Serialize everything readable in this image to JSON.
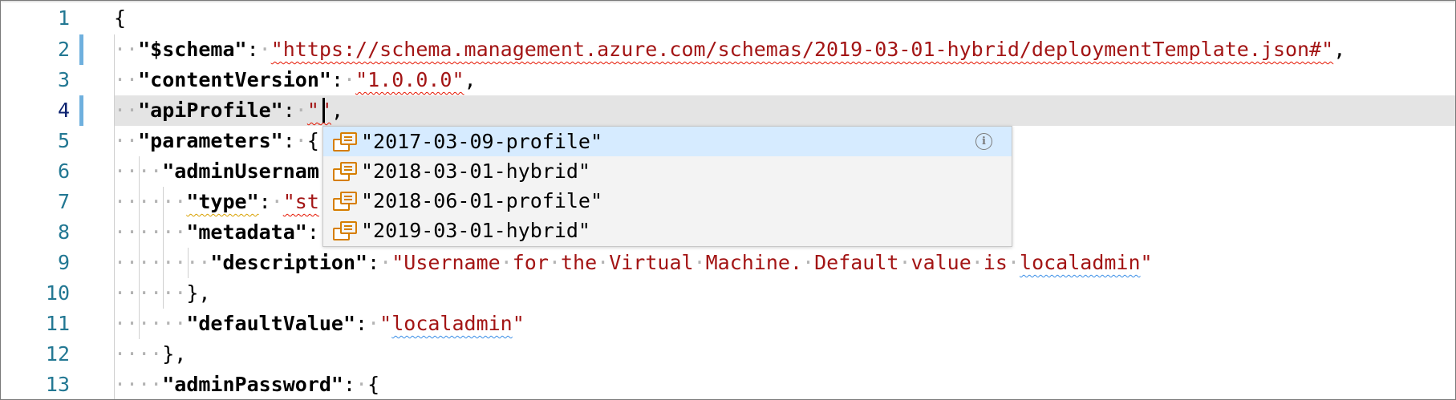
{
  "editor": {
    "language": "json",
    "line_numbers": [
      "1",
      "2",
      "3",
      "4",
      "5",
      "6",
      "7",
      "8",
      "9",
      "10",
      "11",
      "12",
      "13"
    ],
    "active_line": "4",
    "modified_lines": [
      "2",
      "4"
    ],
    "lines": {
      "l1": {
        "brace": "{"
      },
      "l2": {
        "key": "\"$schema\"",
        "colon": ":",
        "value": "\"https://schema.management.azure.com/schemas/2019-03-01-hybrid/deploymentTemplate.json#\"",
        "comma": ","
      },
      "l3": {
        "key": "\"contentVersion\"",
        "colon": ":",
        "value": "\"1.0.0.0\"",
        "comma": ","
      },
      "l4": {
        "key": "\"apiProfile\"",
        "colon": ":",
        "value_open": "\"",
        "value_close": "\"",
        "comma": ","
      },
      "l5": {
        "key": "\"parameters\"",
        "colon": ":",
        "brace": "{"
      },
      "l6": {
        "key": "\"adminUsernam"
      },
      "l7": {
        "key": "\"type\"",
        "colon": ":",
        "value": "\"st"
      },
      "l8": {
        "key": "\"metadata\"",
        "colon": ":"
      },
      "l9": {
        "key": "\"description\"",
        "colon": ":",
        "value_words": [
          "\"Username",
          "for",
          "the",
          "Virtual",
          "Machine.",
          "Default",
          "value",
          "is"
        ],
        "value_last": "localadmin",
        "value_end": "\""
      },
      "l10": {
        "close": "},"
      },
      "l11": {
        "key": "\"defaultValue\"",
        "colon": ":",
        "quote_open": "\"",
        "value": "localadmin",
        "quote_close": "\""
      },
      "l12": {
        "close": "},"
      },
      "l13": {
        "key": "\"adminPassword\"",
        "colon": ":",
        "brace": "{"
      }
    },
    "colors": {
      "string": "#a31515",
      "line_number": "#237893",
      "active_line_number": "#0b216f",
      "gutter_modified": "#6fb0de",
      "current_line_bg": "#e4e4e4",
      "suggest_selected": "#d6ebff"
    }
  },
  "suggest": {
    "items": [
      {
        "label": "\"2017-03-09-profile\"",
        "icon": "value-icon",
        "selected": true
      },
      {
        "label": "\"2018-03-01-hybrid\"",
        "icon": "value-icon",
        "selected": false
      },
      {
        "label": "\"2018-06-01-profile\"",
        "icon": "value-icon",
        "selected": false
      },
      {
        "label": "\"2019-03-01-hybrid\"",
        "icon": "value-icon",
        "selected": false
      }
    ],
    "info_glyph": "i"
  }
}
